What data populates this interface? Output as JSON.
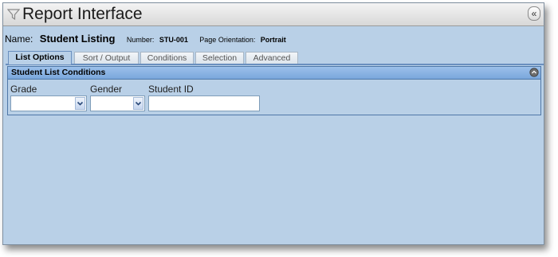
{
  "window": {
    "title": "Report Interface",
    "collapse_glyph": "«"
  },
  "report": {
    "name_label": "Name:",
    "name_value": "Student Listing",
    "number_label": "Number:",
    "number_value": "STU-001",
    "orientation_label": "Page Orientation:",
    "orientation_value": "Portrait"
  },
  "tabs": [
    {
      "label": "List Options",
      "active": true
    },
    {
      "label": "Sort / Output",
      "active": false
    },
    {
      "label": "Conditions",
      "active": false
    },
    {
      "label": "Selection",
      "active": false
    },
    {
      "label": "Advanced",
      "active": false
    }
  ],
  "panel": {
    "title": "Student List Conditions",
    "fields": {
      "grade": {
        "label": "Grade",
        "value": ""
      },
      "gender": {
        "label": "Gender",
        "value": ""
      },
      "student_id": {
        "label": "Student ID",
        "value": ""
      }
    }
  },
  "icons": {
    "title": "filter-icon",
    "collapse": "double-chevron-left-icon",
    "panel_toggle": "circle-arrow-icon",
    "dropdown": "chevron-down-icon"
  },
  "colors": {
    "background": "#b9d0e7",
    "panel_header": "#8fb4e3",
    "active_tab_border": "#6a8fbf"
  }
}
